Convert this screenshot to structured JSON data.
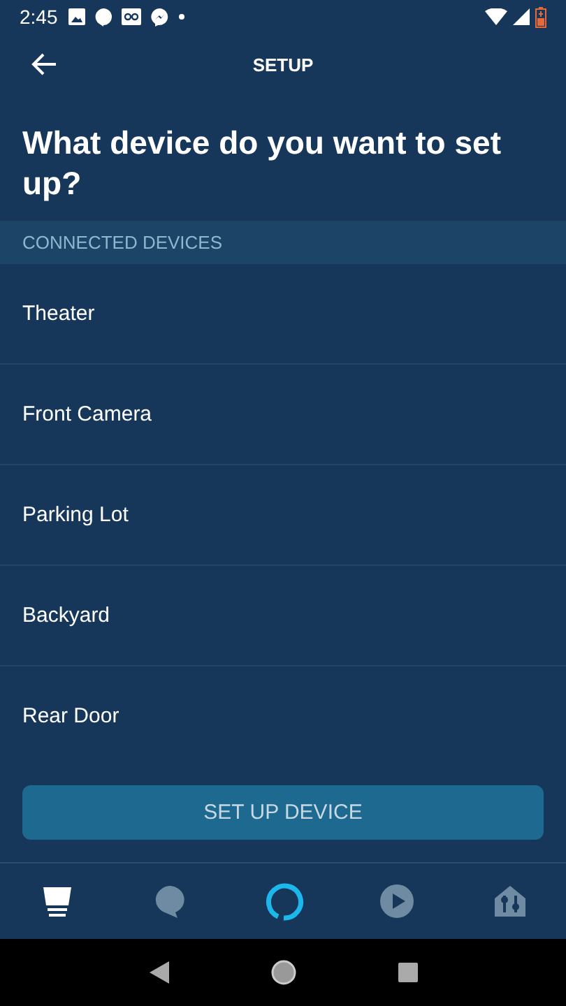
{
  "status_bar": {
    "time": "2:45"
  },
  "app_bar": {
    "title": "SETUP"
  },
  "heading": "What device do you want to set up?",
  "section": {
    "title": "CONNECTED DEVICES"
  },
  "devices": [
    {
      "name": "Theater"
    },
    {
      "name": "Front Camera"
    },
    {
      "name": "Parking Lot"
    },
    {
      "name": "Backyard"
    },
    {
      "name": "Rear Door"
    }
  ],
  "primary_button": {
    "label": "SET UP DEVICE"
  },
  "bottom_nav": [
    {
      "kind": "home",
      "selected": true
    },
    {
      "kind": "chat",
      "selected": false
    },
    {
      "kind": "assistant",
      "selected": false
    },
    {
      "kind": "play",
      "selected": false
    },
    {
      "kind": "devices",
      "selected": false
    }
  ]
}
